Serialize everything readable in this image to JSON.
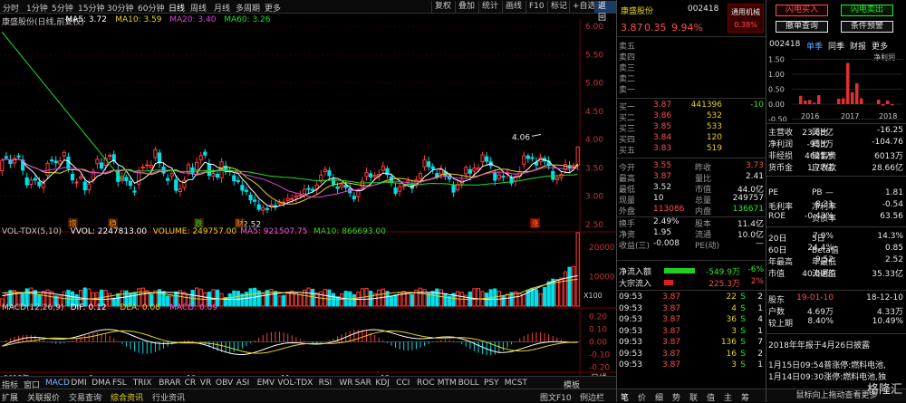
{
  "topbar": {
    "periods": [
      "分时",
      "1分钟",
      "5分钟",
      "15分钟",
      "30分钟",
      "60分钟",
      "日线",
      "周线",
      "月线",
      "多周期",
      "更多"
    ],
    "active": "日线",
    "buttons": [
      "复权",
      "叠加",
      "统计",
      "画线",
      "F10",
      "标记",
      "+自选",
      "返回"
    ]
  },
  "stock": {
    "name": "康盛股份",
    "code": "002418",
    "price": "3.87",
    "change": "0.35",
    "pct": "9.94%",
    "sector": "通用机械",
    "sector_pct": "0.38%"
  },
  "ma": {
    "title": "康盛股份(日线,前复权)",
    "ma5": "MA5: 3.72",
    "ma10": "MA10: 3.59",
    "ma20": "MA20: 3.40",
    "ma60": "MA60: 3.26"
  },
  "price_axis": [
    "6.00",
    "5.50",
    "5.00",
    "4.50",
    "4.00",
    "3.50",
    "3.00",
    "2.50"
  ],
  "annot": {
    "high": "4.06",
    "low": "2.52",
    "tags": [
      "增",
      "稳",
      "跌",
      "财",
      "涨"
    ]
  },
  "vol": {
    "title": "VOL-TDX(5,10)",
    "vvol": "VVOL: 2247813.00",
    "volume": "VOLUME: 249757.00",
    "ma5": "MA5: 921507.75",
    "ma10": "MA10: 866693.00",
    "axis": [
      "20000",
      "10000"
    ],
    "unit": "X100"
  },
  "macd": {
    "title": "MACD(12,26,9)",
    "dif": "DIF: 0.12",
    "dea": "DEA: 0.08",
    "macd": "MACD: 0.09",
    "axis": [
      "0.20",
      "0.10",
      "0.00",
      "-0.10",
      "-0.20"
    ]
  },
  "date_axis": [
    "2018年",
    "9",
    "10",
    "11",
    "12"
  ],
  "date_axis_end": "日线",
  "bottom_tabs": [
    "指标",
    "窗口",
    "MACD",
    "DMI",
    "DMA",
    "FSL",
    "TRIX",
    "BRAR",
    "CR",
    "VR",
    "OBV",
    "ASI",
    "EMV",
    "VOL-TDX",
    "RSI",
    "WR",
    "SAR",
    "KDJ",
    "CCI",
    "ROC",
    "MTM",
    "BOLL",
    "PSY",
    "MCST"
  ],
  "bottom_tabs_end": "模板",
  "status_tabs": [
    "扩展",
    "关联报价",
    "交易查询",
    "综合资讯",
    "行业资讯"
  ],
  "status_end": "图文F10",
  "status_end2": "例边栏",
  "orderbook": {
    "sell_labels": [
      "卖五",
      "卖四",
      "卖三",
      "卖二",
      "卖一"
    ],
    "buy": [
      {
        "l": "买一",
        "p": "3.87",
        "v": "441396",
        "d": "-10"
      },
      {
        "l": "买二",
        "p": "3.86",
        "v": "532",
        "d": ""
      },
      {
        "l": "买三",
        "p": "3.85",
        "v": "533",
        "d": ""
      },
      {
        "l": "买四",
        "p": "3.84",
        "v": "120",
        "d": ""
      },
      {
        "l": "买五",
        "p": "3.83",
        "v": "519",
        "d": ""
      }
    ]
  },
  "quote": [
    {
      "a": "今开",
      "b": "3.55",
      "c": "昨收",
      "d": "3.73"
    },
    {
      "a": "最高",
      "b": "3.87",
      "c": "量比",
      "d": "2.41"
    },
    {
      "a": "最低",
      "b": "3.52",
      "c": "市值",
      "d": "44.0亿"
    },
    {
      "a": "现量",
      "b": "10",
      "c": "总量",
      "d": "249757"
    },
    {
      "a": "外盘",
      "b": "113086",
      "c": "内盘",
      "d": "136671"
    },
    {
      "a": "换手",
      "b": "2.49%",
      "c": "股本",
      "d": "11.4亿"
    },
    {
      "a": "净资",
      "b": "1.95",
      "c": "流通",
      "d": "10.0亿"
    },
    {
      "a": "收益(三)",
      "b": "-0.008",
      "c": "PE(动)",
      "d": "—"
    }
  ],
  "flow": [
    {
      "l": "净流入额",
      "v": "-549.9万",
      "p": "-6%"
    },
    {
      "l": "大宗流入",
      "v": "225.3万",
      "p": "2%"
    }
  ],
  "ticks": [
    {
      "t": "09:53",
      "p": "3.87",
      "v": "22",
      "s": "S",
      "n": "2"
    },
    {
      "t": "09:53",
      "p": "3.87",
      "v": "4",
      "s": "S",
      "n": "1"
    },
    {
      "t": "09:53",
      "p": "3.87",
      "v": "36",
      "s": "S",
      "n": "4"
    },
    {
      "t": "09:53",
      "p": "3.87",
      "v": "3",
      "s": "S",
      "n": "1"
    },
    {
      "t": "09:53",
      "p": "3.87",
      "v": "136",
      "s": "S",
      "n": "7"
    },
    {
      "t": "09:53",
      "p": "3.87",
      "v": "16",
      "s": "S",
      "n": "2"
    },
    {
      "t": "09:53",
      "p": "3.87",
      "v": "3",
      "s": "S",
      "n": "1"
    }
  ],
  "ticks_first": "09:53",
  "bottom_icons": [
    "笔",
    "价",
    "细",
    "势",
    "联",
    "值",
    "主",
    "筹"
  ],
  "fp": {
    "btn1": "闪电买入",
    "btn2": "闪电卖出",
    "btn3": "撤单查询",
    "btn4": "条件预警",
    "code": "002418",
    "tabs": [
      "单季",
      "同季",
      "财报",
      "更多"
    ],
    "chart_unit": "净利润",
    "years": [
      "2016",
      "2017",
      "2018"
    ],
    "axis": [
      "1.50",
      "1.00",
      "0.50",
      "0.00",
      "-0.50"
    ],
    "rows": [
      {
        "a": "主营收",
        "b": "23.88亿",
        "c": "同比",
        "d": "-16.25"
      },
      {
        "a": "净利润",
        "b": "-953万",
        "c": "同比",
        "d": "-104.76"
      },
      {
        "a": "非经损",
        "b": "4621万",
        "c": "销售费",
        "d": "6013万"
      },
      {
        "a": "货币金",
        "b": "1.77亿",
        "c": "应收款",
        "d": "28.66亿"
      }
    ],
    "rows2": [
      {
        "a": "PE",
        "b": "—",
        "c": "PB",
        "d": "1.81"
      },
      {
        "a": "毛利率",
        "b": "8.31",
        "c": "净利率",
        "d": "-0.54"
      },
      {
        "a": "ROE",
        "b": "-0.43%",
        "c": "负债率",
        "d": "63.56"
      }
    ],
    "rows3": [
      {
        "a": "20日",
        "b": "7.0%",
        "c": "5日",
        "d": "14.3%"
      },
      {
        "a": "60日",
        "b": "24.4%",
        "c": "Beta值",
        "d": "0.85"
      },
      {
        "a": "年最高",
        "b": "9.52",
        "c": "年最低",
        "d": "2.52"
      },
      {
        "a": "市值",
        "b": "40.00亿",
        "c": "流通值",
        "d": "35.33亿"
      }
    ],
    "rows4": [
      {
        "a": "股东",
        "b": "19-01-10",
        "c": "",
        "d": "18-12-10"
      },
      {
        "a": "户数",
        "b": "4.69万",
        "c": "",
        "d": "4.33万"
      },
      {
        "a": "较上期",
        "b": "8.40%",
        "c": "",
        "d": "10.49%"
      }
    ],
    "news0": "2018年年报于4月26日披露",
    "news": [
      "1月15日09:54普涨停:燃料电池,",
      "1月14日09:30涨停:燃料电池,独"
    ],
    "bottom": "鼠标向上拖动查看更多",
    "watermark": "格隆汇"
  },
  "bars2016": [
    0.28,
    0.12,
    0.14,
    0.05,
    0.3
  ],
  "bars2017": [
    0.18,
    0.2,
    1.38,
    0.4,
    0.7,
    0.2
  ],
  "bars2018": [
    0.15,
    -0.05,
    0.12,
    -0.04
  ],
  "chart_data": {
    "type": "candlestick",
    "title": "康盛股份(日线,前复权)",
    "ylim": [
      2.4,
      6.1
    ],
    "high": 4.06,
    "low": 2.52,
    "last": 3.87
  }
}
